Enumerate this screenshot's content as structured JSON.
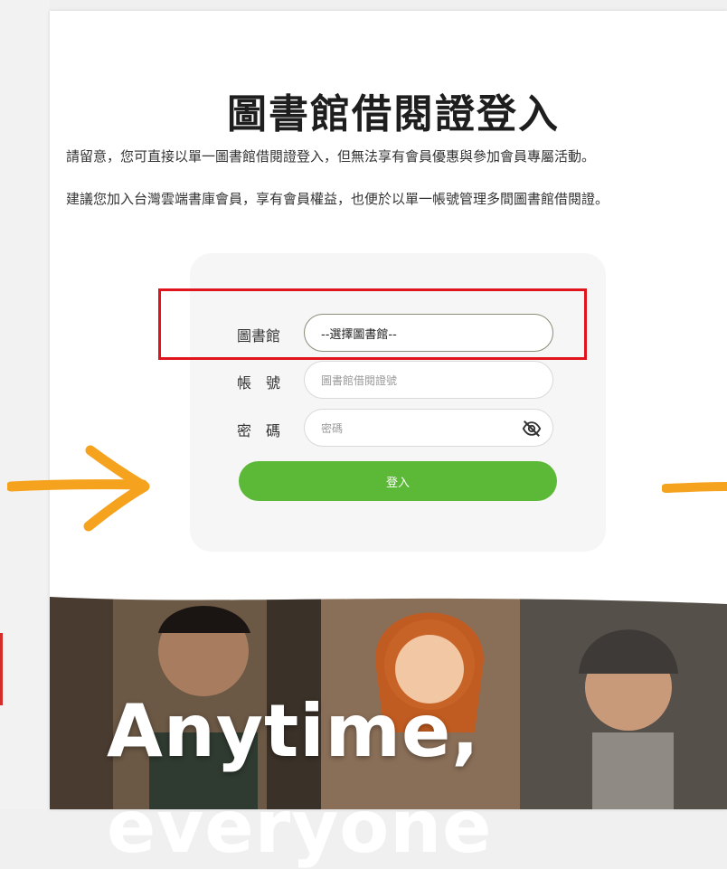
{
  "login": {
    "title": "圖書館借閱證登入",
    "notice_line1": "請留意，您可直接以單一圖書館借閱證登入，但無法享有會員優惠與參加會員專屬活動。",
    "notice_line2": "建議您加入台灣雲端書庫會員，享有會員權益，也便於以單一帳號管理多間圖書館借閱證。",
    "fields": {
      "library_label": "圖書館",
      "library_value": "--選擇圖書館--",
      "account_label": "帳　號",
      "account_placeholder": "圖書館借閱證號",
      "password_label": "密　碼",
      "password_placeholder": "密碼"
    },
    "submit_label": "登入"
  },
  "hero": {
    "headline_line1": "Anytime,",
    "headline_line2": "everyone"
  },
  "colors": {
    "accent_green": "#5cb837",
    "highlight_red": "#e0141c",
    "arrow_orange": "#f5a31f"
  },
  "icons": {
    "password_toggle": "eye-off-icon",
    "pointer_left": "arrow-right-icon",
    "pointer_right": "arrow-left-icon"
  }
}
